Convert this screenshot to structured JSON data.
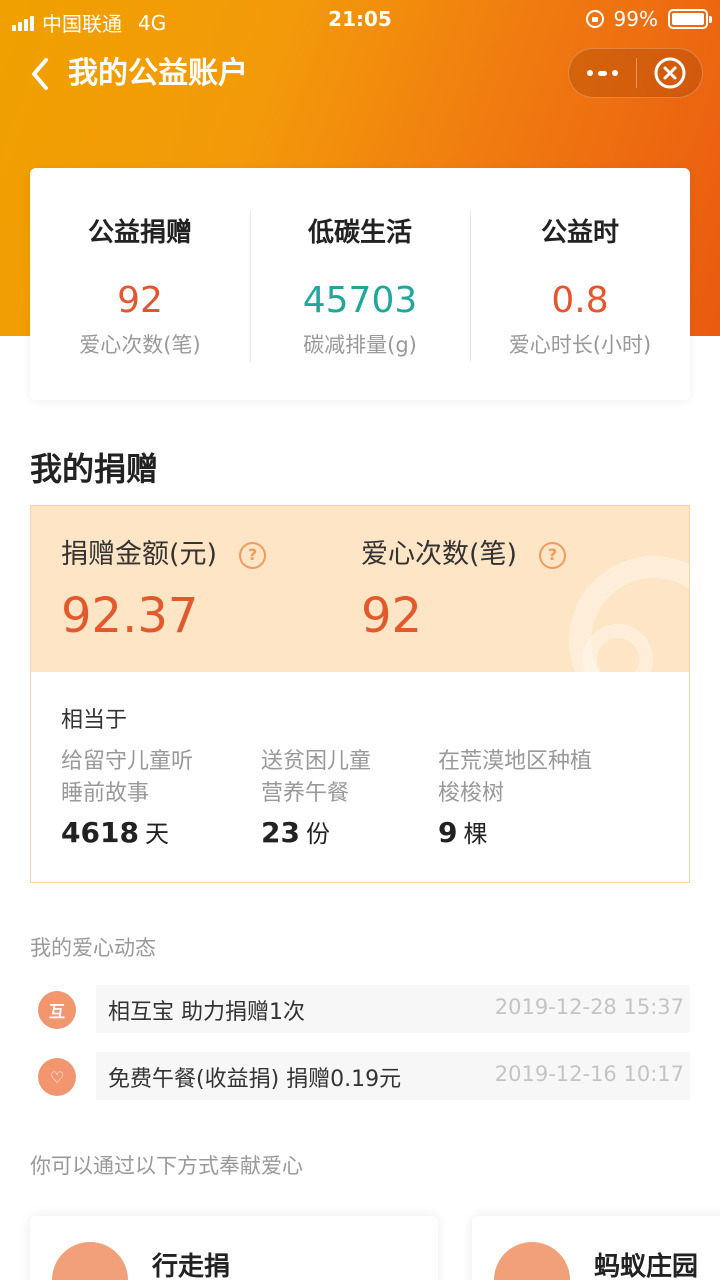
{
  "status_bar": {
    "carrier": "中国联通",
    "network": "4G",
    "time": "21:05",
    "battery": "99%"
  },
  "nav": {
    "title": "我的公益账户"
  },
  "summary": [
    {
      "title": "公益捐赠",
      "value": "92",
      "sub": "爱心次数(笔)",
      "color": "#e4572e"
    },
    {
      "title": "低碳生活",
      "value": "45703",
      "sub": "碳减排量(g)",
      "color": "#1fa89a"
    },
    {
      "title": "公益时",
      "value": "0.8",
      "sub": "爱心时长(小时)",
      "color": "#e4572e"
    }
  ],
  "donation": {
    "section_title": "我的捐赠",
    "amount_label": "捐赠金额(元)",
    "amount_value": "92.37",
    "count_label": "爱心次数(笔)",
    "count_value": "92",
    "help_icon": "?",
    "equivalent_label": "相当于",
    "equivalents": [
      {
        "line1": "给留守儿童听",
        "line2": "睡前故事",
        "number": "4618",
        "unit": "天"
      },
      {
        "line1": "送贫困儿童",
        "line2": "营养午餐",
        "number": "23",
        "unit": "份"
      },
      {
        "line1": "在荒漠地区种植",
        "line2": "梭梭树",
        "number": "9",
        "unit": "棵"
      }
    ]
  },
  "activity": {
    "title": "我的爱心动态",
    "items": [
      {
        "icon": "互",
        "text": "相互宝 助力捐赠1次",
        "time": "2019-12-28 15:37"
      },
      {
        "icon": "♡",
        "text": "免费午餐(收益捐) 捐赠0.19元",
        "time": "2019-12-16 10:17"
      }
    ]
  },
  "ways": {
    "title": "你可以通过以下方式奉献爱心",
    "items": [
      {
        "name": "行走捐"
      },
      {
        "name": "蚂蚁庄园"
      }
    ]
  },
  "colors": {
    "accent_orange": "#e4572e",
    "accent_teal": "#1fa89a",
    "card_highlight": "#fde5c5"
  }
}
